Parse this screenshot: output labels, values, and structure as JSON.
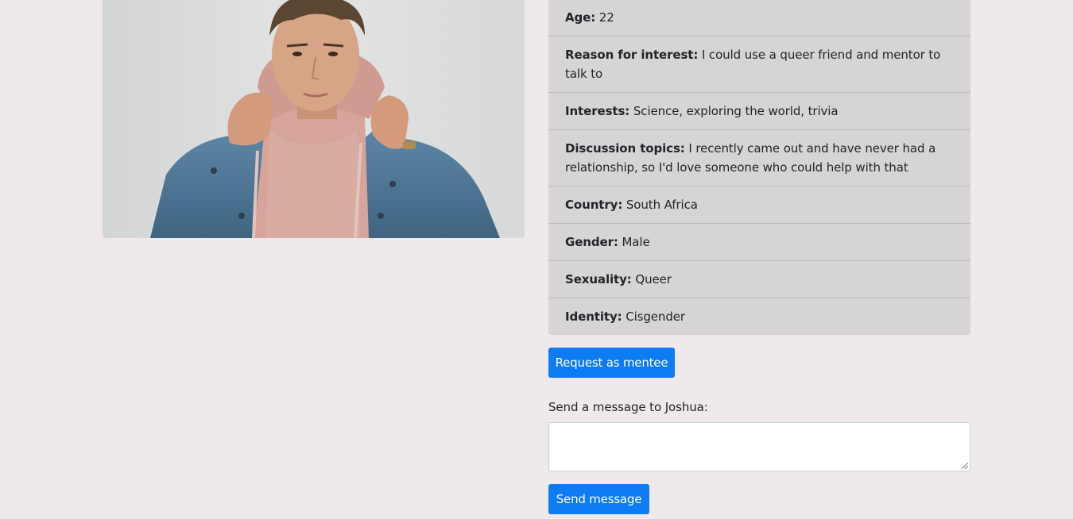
{
  "profile": {
    "fields": [
      {
        "label": "Age:",
        "value": "22"
      },
      {
        "label": "Reason for interest:",
        "value": "I could use a queer friend and mentor to talk to"
      },
      {
        "label": "Interests:",
        "value": "Science, exploring the world, trivia"
      },
      {
        "label": "Discussion topics:",
        "value": "I recently came out and have never had a relationship, so I'd love someone who could help with that"
      },
      {
        "label": "Country:",
        "value": "South Africa"
      },
      {
        "label": "Gender:",
        "value": "Male"
      },
      {
        "label": "Sexuality:",
        "value": "Queer"
      },
      {
        "label": "Identity:",
        "value": "Cisgender"
      }
    ]
  },
  "actions": {
    "request_label": "Request as mentee",
    "message_label": "Send a message to Joshua:",
    "message_value": "",
    "send_label": "Send message"
  },
  "colors": {
    "accent": "#0d7bf2",
    "page_bg": "#efe9e9",
    "card_bg": "#d6d4d5"
  }
}
